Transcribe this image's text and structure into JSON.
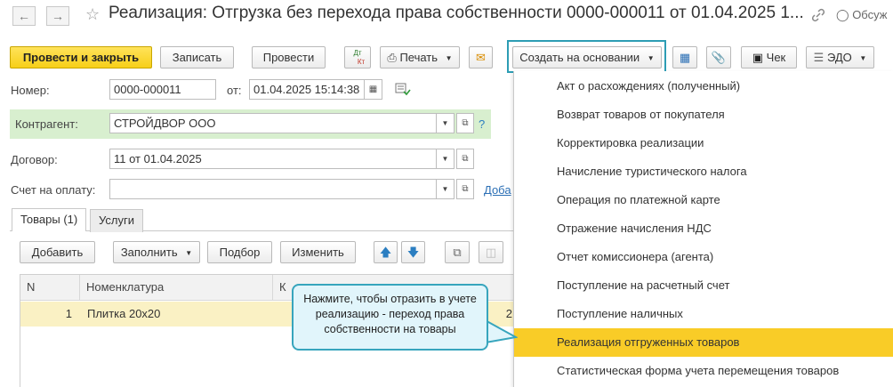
{
  "window": {
    "title": "Реализация: Отгрузка без перехода права собственности 0000-000011 от 01.04.2025 1...",
    "back_icon": "arrow-left-icon",
    "forward_icon": "arrow-right-icon",
    "star_icon": "star-icon",
    "link_icon": "link-icon",
    "discuss_label": "Обсуж"
  },
  "toolbar": {
    "post_close_label": "Провести и закрыть",
    "save_label": "Записать",
    "post_label": "Провести",
    "dt_kt_top": "Дт",
    "dt_kt_bottom": "Кт",
    "print_label": "Печать",
    "create_based_label": "Создать на основании",
    "receipt_label": "Чек",
    "edo_label": "ЭДО"
  },
  "form": {
    "number_label": "Номер:",
    "number_value": "0000-000011",
    "from_label": "от:",
    "date_value": "01.04.2025 15:14:38",
    "counterparty_label": "Контрагент:",
    "counterparty_value": "СТРОЙДВОР ООО",
    "help_mark": "?",
    "contract_label": "Договор:",
    "contract_value": "11 от 01.04.2025",
    "invoice_label": "Счет на оплату:",
    "invoice_value": "",
    "add_link": "Доба"
  },
  "tabs": [
    {
      "label": "Товары (1)"
    },
    {
      "label": "Услуги"
    }
  ],
  "table_toolbar": {
    "add_label": "Добавить",
    "fill_label": "Заполнить",
    "select_label": "Подбор",
    "change_label": "Изменить"
  },
  "table": {
    "columns": [
      "N",
      "Номенклатура",
      "К"
    ],
    "rows": [
      {
        "n": "1",
        "item": "Плитка 20x20",
        "extra": "2"
      }
    ]
  },
  "menu": {
    "items": [
      "Акт о расхождениях (полученный)",
      "Возврат товаров от покупателя",
      "Корректировка реализации",
      "Начисление туристического налога",
      "Операция по платежной карте",
      "Отражение начисления НДС",
      "Отчет комиссионера (агента)",
      "Поступление на расчетный счет",
      "Поступление наличных",
      "Реализация отгруженных товаров",
      "Статистическая форма учета перемещения товаров"
    ],
    "active_index": 9
  },
  "callout": {
    "text": "Нажмите, чтобы отразить в учете реализацию - переход права собственности на товары"
  },
  "colors": {
    "primary_button": "#f7cf18",
    "highlight_row": "#f9cc27",
    "counterparty_bg": "#d8efcf",
    "callout_border": "#37a5bd",
    "callout_bg": "#e1f5fb",
    "selected_row": "#faf1c4"
  }
}
